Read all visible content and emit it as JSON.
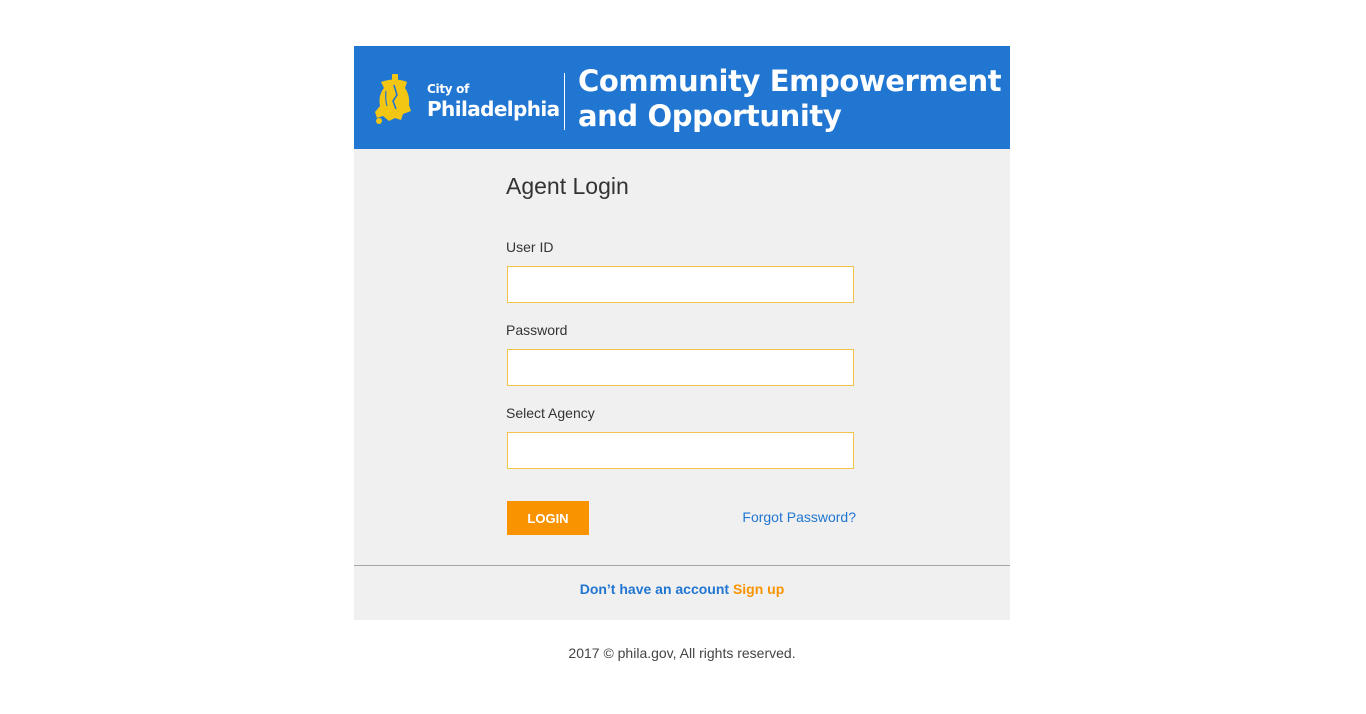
{
  "header": {
    "logo_line1": "City of",
    "logo_line2": "Philadelphia",
    "title_line1": "Community Empowerment",
    "title_line2": "and Opportunity",
    "bg_color": "#2176d2",
    "logo_icon": "liberty-bell-icon",
    "logo_color": "#f3c613"
  },
  "form": {
    "title": "Agent Login",
    "fields": [
      {
        "label": "User ID",
        "value": "",
        "type": "text"
      },
      {
        "label": "Password",
        "value": "",
        "type": "password"
      },
      {
        "label": "Select Agency",
        "value": "",
        "type": "text"
      }
    ],
    "login_label": "LOGIN",
    "forgot_label": "Forgot Password?",
    "accent_color": "#f99300",
    "field_border_color": "#f2c44c"
  },
  "signup": {
    "prompt": "Don’t have an account",
    "link": "Sign up"
  },
  "footer": {
    "copyright": "2017 © phila.gov, All rights reserved."
  }
}
